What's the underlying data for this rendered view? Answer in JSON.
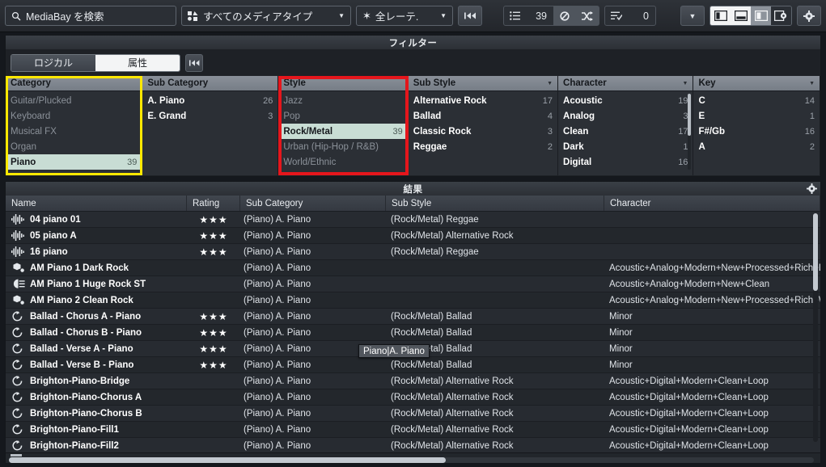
{
  "toolbar": {
    "search_placeholder": "MediaBay を検索",
    "search_value": "",
    "media_type_label": "すべてのメディアタイプ",
    "rating_label": "全レーテ.",
    "reset_icon": "rewind-icon",
    "list_icon": "list-icon",
    "count_results": "39",
    "loop_icon": "loop-icon",
    "shuffle_icon": "shuffle-icon",
    "selected_icon": "checklist-icon",
    "count_selected": "0",
    "dropdown_icon": "chevron-down-icon",
    "view_left_icon": "panel-left-icon",
    "view_bottom_icon": "panel-bottom-icon",
    "view_right_icon": "panel-right-icon",
    "view_config_icon": "panel-gear-icon",
    "settings_icon": "gear-icon"
  },
  "filter": {
    "title": "フィルター",
    "tab_logical": "ロジカル",
    "tab_attribute": "属性",
    "reset_icon": "rewind-icon",
    "active_tab": "属性",
    "columns": [
      {
        "header": "Category",
        "highlight": "#ffe800",
        "has_caret": false,
        "items": [
          {
            "label": "Guitar/Plucked",
            "count": "",
            "state": "dim"
          },
          {
            "label": "Keyboard",
            "count": "",
            "state": "dim"
          },
          {
            "label": "Musical FX",
            "count": "",
            "state": "dim"
          },
          {
            "label": "Organ",
            "count": "",
            "state": "dim"
          },
          {
            "label": "Piano",
            "count": "39",
            "state": "selected"
          }
        ]
      },
      {
        "header": "Sub Category",
        "highlight": "",
        "has_caret": false,
        "items": [
          {
            "label": "A. Piano",
            "count": "26",
            "state": "normal"
          },
          {
            "label": "E. Grand",
            "count": "3",
            "state": "normal"
          }
        ]
      },
      {
        "header": "Style",
        "highlight": "#e5161c",
        "has_caret": false,
        "items": [
          {
            "label": "Jazz",
            "count": "",
            "state": "dim"
          },
          {
            "label": "Pop",
            "count": "",
            "state": "dim"
          },
          {
            "label": "Rock/Metal",
            "count": "39",
            "state": "selected"
          },
          {
            "label": "Urban (Hip-Hop / R&B)",
            "count": "",
            "state": "dim"
          },
          {
            "label": "World/Ethnic",
            "count": "",
            "state": "dim"
          }
        ]
      },
      {
        "header": "Sub Style",
        "highlight": "",
        "has_caret": true,
        "items": [
          {
            "label": "Alternative Rock",
            "count": "17",
            "state": "normal"
          },
          {
            "label": "Ballad",
            "count": "4",
            "state": "normal"
          },
          {
            "label": "Classic Rock",
            "count": "3",
            "state": "normal"
          },
          {
            "label": "Reggae",
            "count": "2",
            "state": "normal"
          }
        ]
      },
      {
        "header": "Character",
        "highlight": "",
        "has_caret": true,
        "scrollbar": true,
        "items": [
          {
            "label": "Acoustic",
            "count": "19",
            "state": "normal"
          },
          {
            "label": "Analog",
            "count": "3",
            "state": "normal"
          },
          {
            "label": "Clean",
            "count": "17",
            "state": "normal"
          },
          {
            "label": "Dark",
            "count": "1",
            "state": "normal"
          },
          {
            "label": "Digital",
            "count": "16",
            "state": "normal"
          }
        ]
      },
      {
        "header": "Key",
        "highlight": "",
        "has_caret": true,
        "items": [
          {
            "label": "C",
            "count": "14",
            "state": "normal"
          },
          {
            "label": "E",
            "count": "1",
            "state": "normal"
          },
          {
            "label": "F#/Gb",
            "count": "16",
            "state": "normal"
          },
          {
            "label": "A",
            "count": "2",
            "state": "normal"
          }
        ]
      }
    ]
  },
  "results": {
    "title": "結果",
    "settings_icon": "gear-icon",
    "headers": [
      "Name",
      "Rating",
      "Sub Category",
      "Sub Style",
      "Character"
    ],
    "tooltip": "Piano|A. Piano",
    "rows": [
      {
        "icon": "waveform-icon",
        "name": "04 piano 01",
        "rating": "★★★",
        "sub_category": "(Piano) A. Piano",
        "sub_style": "(Rock/Metal) Reggae",
        "character": ""
      },
      {
        "icon": "waveform-icon",
        "name": "05 piano A",
        "rating": "★★★",
        "sub_category": "(Piano) A. Piano",
        "sub_style": "(Rock/Metal) Alternative Rock",
        "character": ""
      },
      {
        "icon": "waveform-icon",
        "name": "16 piano",
        "rating": "★★★",
        "sub_category": "(Piano) A. Piano",
        "sub_style": "(Rock/Metal) Reggae",
        "character": ""
      },
      {
        "icon": "preset-icon",
        "name": "AM Piano 1 Dark Rock",
        "rating": "",
        "sub_category": "(Piano) A. Piano",
        "sub_style": "",
        "character": "Acoustic+Analog+Modern+New+Processed+Rich+D"
      },
      {
        "icon": "multi-preset-icon",
        "name": "AM Piano 1 Huge Rock ST",
        "rating": "",
        "sub_category": "(Piano) A. Piano",
        "sub_style": "",
        "character": "Acoustic+Analog+Modern+New+Clean"
      },
      {
        "icon": "preset-icon",
        "name": "AM Piano 2 Clean Rock",
        "rating": "",
        "sub_category": "(Piano) A. Piano",
        "sub_style": "",
        "character": "Acoustic+Analog+Modern+New+Processed+Rich+W"
      },
      {
        "icon": "midi-loop-icon",
        "name": "Ballad - Chorus A - Piano",
        "rating": "★★★",
        "sub_category": "(Piano) A. Piano",
        "sub_style": "(Rock/Metal) Ballad",
        "character": "Minor"
      },
      {
        "icon": "midi-loop-icon",
        "name": "Ballad - Chorus B - Piano",
        "rating": "★★★",
        "sub_category": "(Piano) A. Piano",
        "sub_style": "(Rock/Metal) Ballad",
        "character": "Minor"
      },
      {
        "icon": "midi-loop-icon",
        "name": "Ballad - Verse A - Piano",
        "rating": "★★★",
        "sub_category": "(Piano) A. Piano",
        "sub_style": "(Rock/Metal) Ballad",
        "character": "Minor"
      },
      {
        "icon": "midi-loop-icon",
        "name": "Ballad - Verse B - Piano",
        "rating": "★★★",
        "sub_category": "(Piano) A. Piano",
        "sub_style": "(Rock/Metal) Ballad",
        "character": "Minor"
      },
      {
        "icon": "midi-loop-icon",
        "name": "Brighton-Piano-Bridge",
        "rating": "",
        "sub_category": "(Piano) A. Piano",
        "sub_style": "(Rock/Metal) Alternative Rock",
        "character": "Acoustic+Digital+Modern+Clean+Loop"
      },
      {
        "icon": "midi-loop-icon",
        "name": "Brighton-Piano-Chorus A",
        "rating": "",
        "sub_category": "(Piano) A. Piano",
        "sub_style": "(Rock/Metal) Alternative Rock",
        "character": "Acoustic+Digital+Modern+Clean+Loop"
      },
      {
        "icon": "midi-loop-icon",
        "name": "Brighton-Piano-Chorus B",
        "rating": "",
        "sub_category": "(Piano) A. Piano",
        "sub_style": "(Rock/Metal) Alternative Rock",
        "character": "Acoustic+Digital+Modern+Clean+Loop"
      },
      {
        "icon": "midi-loop-icon",
        "name": "Brighton-Piano-Fill1",
        "rating": "",
        "sub_category": "(Piano) A. Piano",
        "sub_style": "(Rock/Metal) Alternative Rock",
        "character": "Acoustic+Digital+Modern+Clean+Loop"
      },
      {
        "icon": "midi-loop-icon",
        "name": "Brighton-Piano-Fill2",
        "rating": "",
        "sub_category": "(Piano) A. Piano",
        "sub_style": "(Rock/Metal) Alternative Rock",
        "character": "Acoustic+Digital+Modern+Clean+Loop"
      }
    ]
  }
}
